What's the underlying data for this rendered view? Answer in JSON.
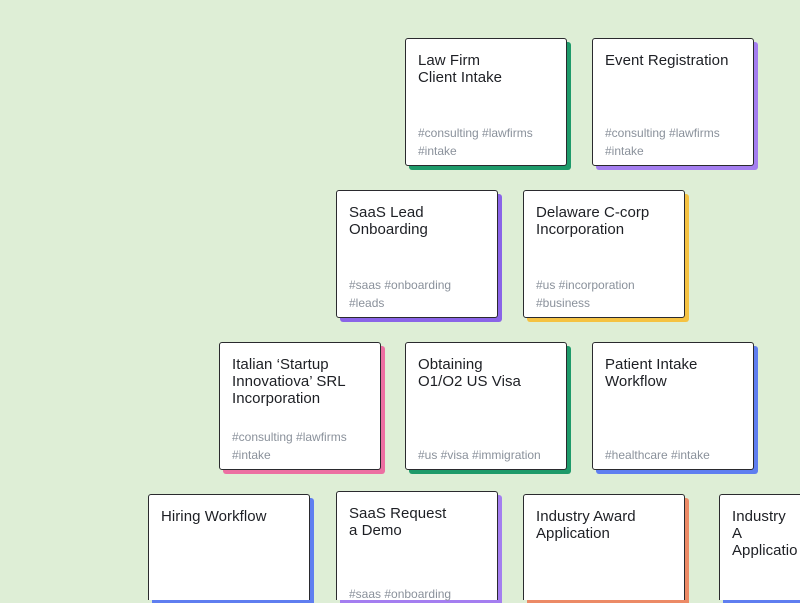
{
  "templates": [
    {
      "title": "Law Firm\nClient Intake",
      "tags": "#consulting  #lawfirms\n#intake",
      "accent": "#1e9a6a"
    },
    {
      "title": "Event Registration",
      "tags": "#consulting  #lawfirms\n#intake",
      "accent": "#a47ef0"
    },
    {
      "title": "SaaS Lead\nOnboarding",
      "tags": "#saas  #onboarding\n#leads",
      "accent": "#8a64e8"
    },
    {
      "title": "Delaware C-corp\nIncorporation",
      "tags": "#us  #incorporation\n#business",
      "accent": "#f5c242"
    },
    {
      "title": "Italian ‘Startup\nInnovatiova’ SRL\nIncorporation",
      "tags": "#consulting  #lawfirms\n#intake",
      "accent": "#ec6fa2"
    },
    {
      "title": "Obtaining\nO1/O2 US Visa",
      "tags": "#us  #visa  #immigration",
      "accent": "#1e9a6a"
    },
    {
      "title": "Patient Intake\nWorkflow",
      "tags": "#healthcare  #intake",
      "accent": "#5f7ef0"
    },
    {
      "title": "Hiring Workflow",
      "tags": "",
      "accent": "#5f7ef0"
    },
    {
      "title": "SaaS Request\na Demo",
      "tags": "#saas  #onboarding",
      "accent": "#a47ef0"
    },
    {
      "title": "Industry Award\nApplication",
      "tags": "",
      "accent": "#ec8a66"
    },
    {
      "title": "Industry A\nApplicatio",
      "tags": "",
      "accent": "#5f7ef0"
    }
  ]
}
